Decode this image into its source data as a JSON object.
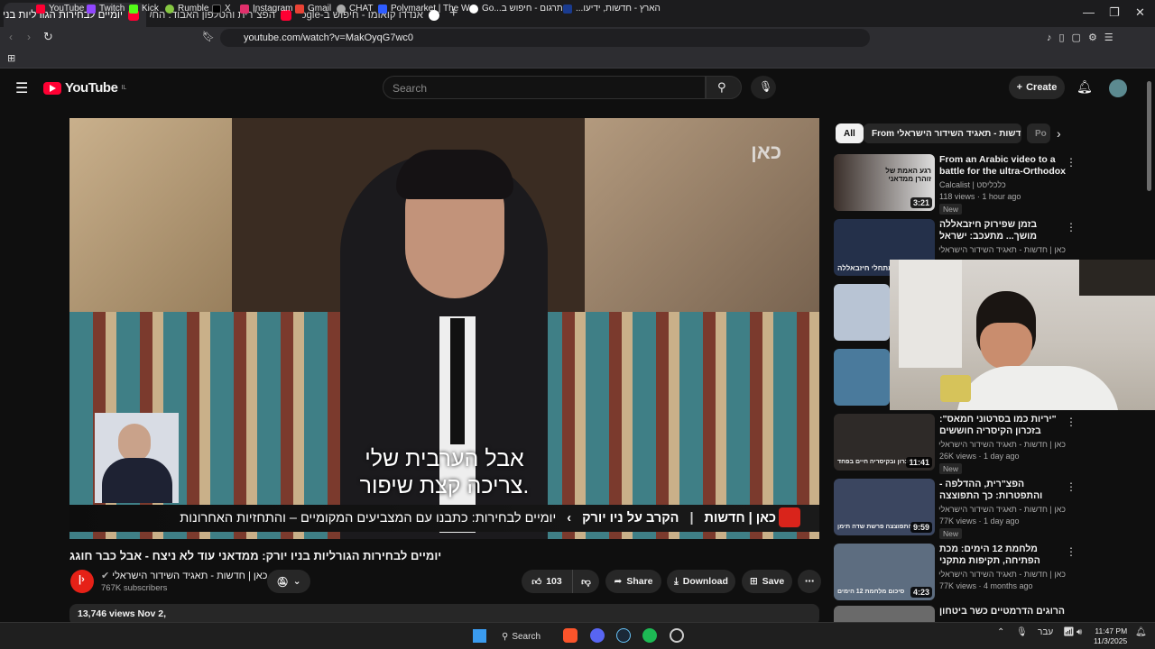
{
  "browser": {
    "tabs": [
      {
        "title": "יומיים לבחירות הגורליות בניו יורק",
        "active": true
      },
      {
        "title": "הפצ\"רית והטלפון האבוד: החשדות נג",
        "active": false
      },
      {
        "title": "אנדרו קואומו - חיפוש ב-Google",
        "active": false
      }
    ],
    "url": "youtube.com/watch?v=MakOyqG7wc0",
    "bookmarks": [
      "YouTube",
      "Twitch",
      "Kick",
      "Rumble",
      "X",
      "Instagram",
      "Gmail",
      "CHAT",
      "Polymarket | The W...",
      "Go...תרגום - חיפוש ב",
      "...הארץ - חדשות, ידיעו"
    ]
  },
  "youtube": {
    "logo_text": "YouTube",
    "region": "IL",
    "search_placeholder": "Search",
    "create_label": "Create",
    "chips": [
      "All",
      "From כאן | חדשות - תאגיד השידור הישראלי",
      "Po"
    ]
  },
  "video": {
    "watermark": "כאן",
    "subtitle_line1": "אבל הערבית שלי",
    "subtitle_line2": "צריכה קצת שיפור.",
    "ticker_brand": "כאן | חדשות",
    "ticker_section": "הקרב על ניו יורק",
    "ticker_text": "יומיים לבחירות: כתבנו עם המצביעים המקומיים – והתחזיות האחרונות",
    "title": "יומיים לבחירות הגורליות בניו יורק: ממדאני עוד לא ניצח - אבל כבר חוגג",
    "channel_name": "כאן | חדשות - תאגיד השידור הישראלי",
    "subscribers": "767K subscribers",
    "likes": "103",
    "share_label": "Share",
    "download_label": "Download",
    "save_label": "Save",
    "views_date": "13,746 views  Nov 2,"
  },
  "recommendations": [
    {
      "title": "From an Arabic video to a battle for the ultra-Orthodox voice: ...",
      "ltr": true,
      "channel": "Calcalist | כלכליסט",
      "views": "118 views · 1 hour ago",
      "badge": "New",
      "duration": "3:21",
      "thumb_text": "רגע האמת\nשל זוהרן\nממדאני",
      "thumb_color": "#5a4a3a"
    },
    {
      "title": "בזמן שפירוק חיזבאללה מושך... מתעכב: ישראל תוקפת בלבנון",
      "ltr": false,
      "channel": "כאן | חדשות - תאגיד השידור הישראלי",
      "views": "",
      "badge": "",
      "duration": "",
      "thumb_text": "מתחלי חיזבאללה",
      "thumb_color": "#24304a"
    },
    {
      "title": "\"יריות כמו בסרטוני חמאס\": בזכרון הקיסריה חוששים מהירי מהישובים",
      "ltr": false,
      "channel": "כאן | חדשות - תאגיד השידור הישראלי",
      "views": "26K views · 1 day ago",
      "badge": "New",
      "duration": "11:41",
      "thumb_text": "ירי בזכרון ובקיסריה חיים בפחד",
      "thumb_color": "#2e2a28"
    },
    {
      "title": "הפצ\"רית, ההדלפה - והתפטרות: כך התפוצצה פרשת שדה תימן",
      "ltr": false,
      "channel": "כאן | חדשות - תאגיד השידור הישראלי",
      "views": "77K views · 1 day ago",
      "badge": "New",
      "duration": "9:59",
      "thumb_text": "כך התפוצצה פרשת שדה תימן",
      "thumb_color": "#3b4660"
    },
    {
      "title": "מלחמת 12 הימים: מכת הפתיחה, תקיפות מתקני הגרעין והאבדות ...",
      "ltr": false,
      "channel": "כאן | חדשות - תאגיד השידור הישראלי",
      "views": "77K views · 4 months ago",
      "badge": "",
      "duration": "4:23",
      "thumb_text": "סיכום מלחמת 12 הימים",
      "thumb_color": "#5d6d80"
    },
    {
      "title": "הרוגים הדרמטיים כשר ביטחון",
      "ltr": false,
      "channel": "",
      "views": "",
      "badge": "",
      "duration": "",
      "thumb_text": "",
      "thumb_color": "#6a6a6a"
    }
  ],
  "taskbar": {
    "search_label": "Search",
    "language": "עבר",
    "time": "11:47 PM",
    "date": "11/3/2025"
  }
}
